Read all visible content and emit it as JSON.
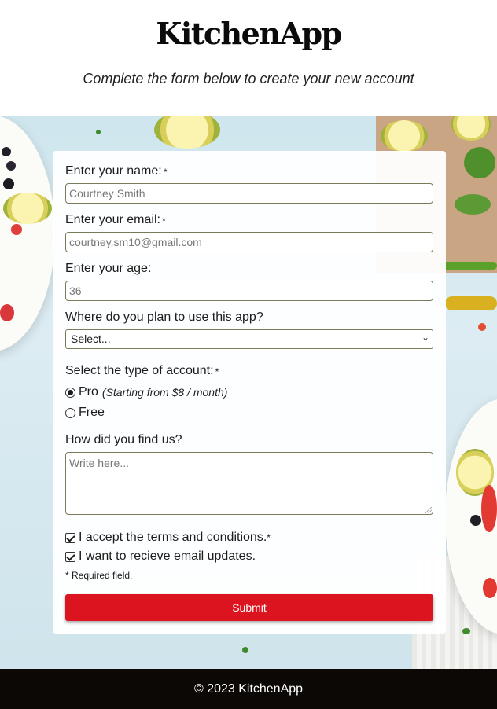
{
  "header": {
    "brand": "KitchenApp",
    "tagline": "Complete the form below to create your new account"
  },
  "form": {
    "name": {
      "label": "Enter your name:",
      "required_mark": "*",
      "placeholder": "Courtney Smith"
    },
    "email": {
      "label": "Enter your email:",
      "required_mark": "*",
      "placeholder": "courtney.sm10@gmail.com"
    },
    "age": {
      "label": "Enter your age:",
      "placeholder": "36"
    },
    "usage": {
      "label": "Where do you plan to use this app?",
      "selected": "Select..."
    },
    "account_type": {
      "label": "Select the type of account:",
      "required_mark": "*",
      "options": [
        {
          "label": "Pro",
          "hint": "(Starting from $8 / month)",
          "checked": true
        },
        {
          "label": "Free",
          "checked": false
        }
      ]
    },
    "referral": {
      "label": "How did you find us?",
      "placeholder": "Write here..."
    },
    "terms": {
      "prefix": "I accept the ",
      "link": "terms and conditions",
      "suffix": ".",
      "required_mark": "*",
      "checked": true
    },
    "updates": {
      "label": "I want to recieve email updates.",
      "checked": true
    },
    "required_note": "* Required field.",
    "submit_label": "Submit"
  },
  "footer": {
    "text": "© 2023 KitchenApp"
  },
  "colors": {
    "accent": "#dc1420",
    "footer_bg": "#0b0805"
  }
}
